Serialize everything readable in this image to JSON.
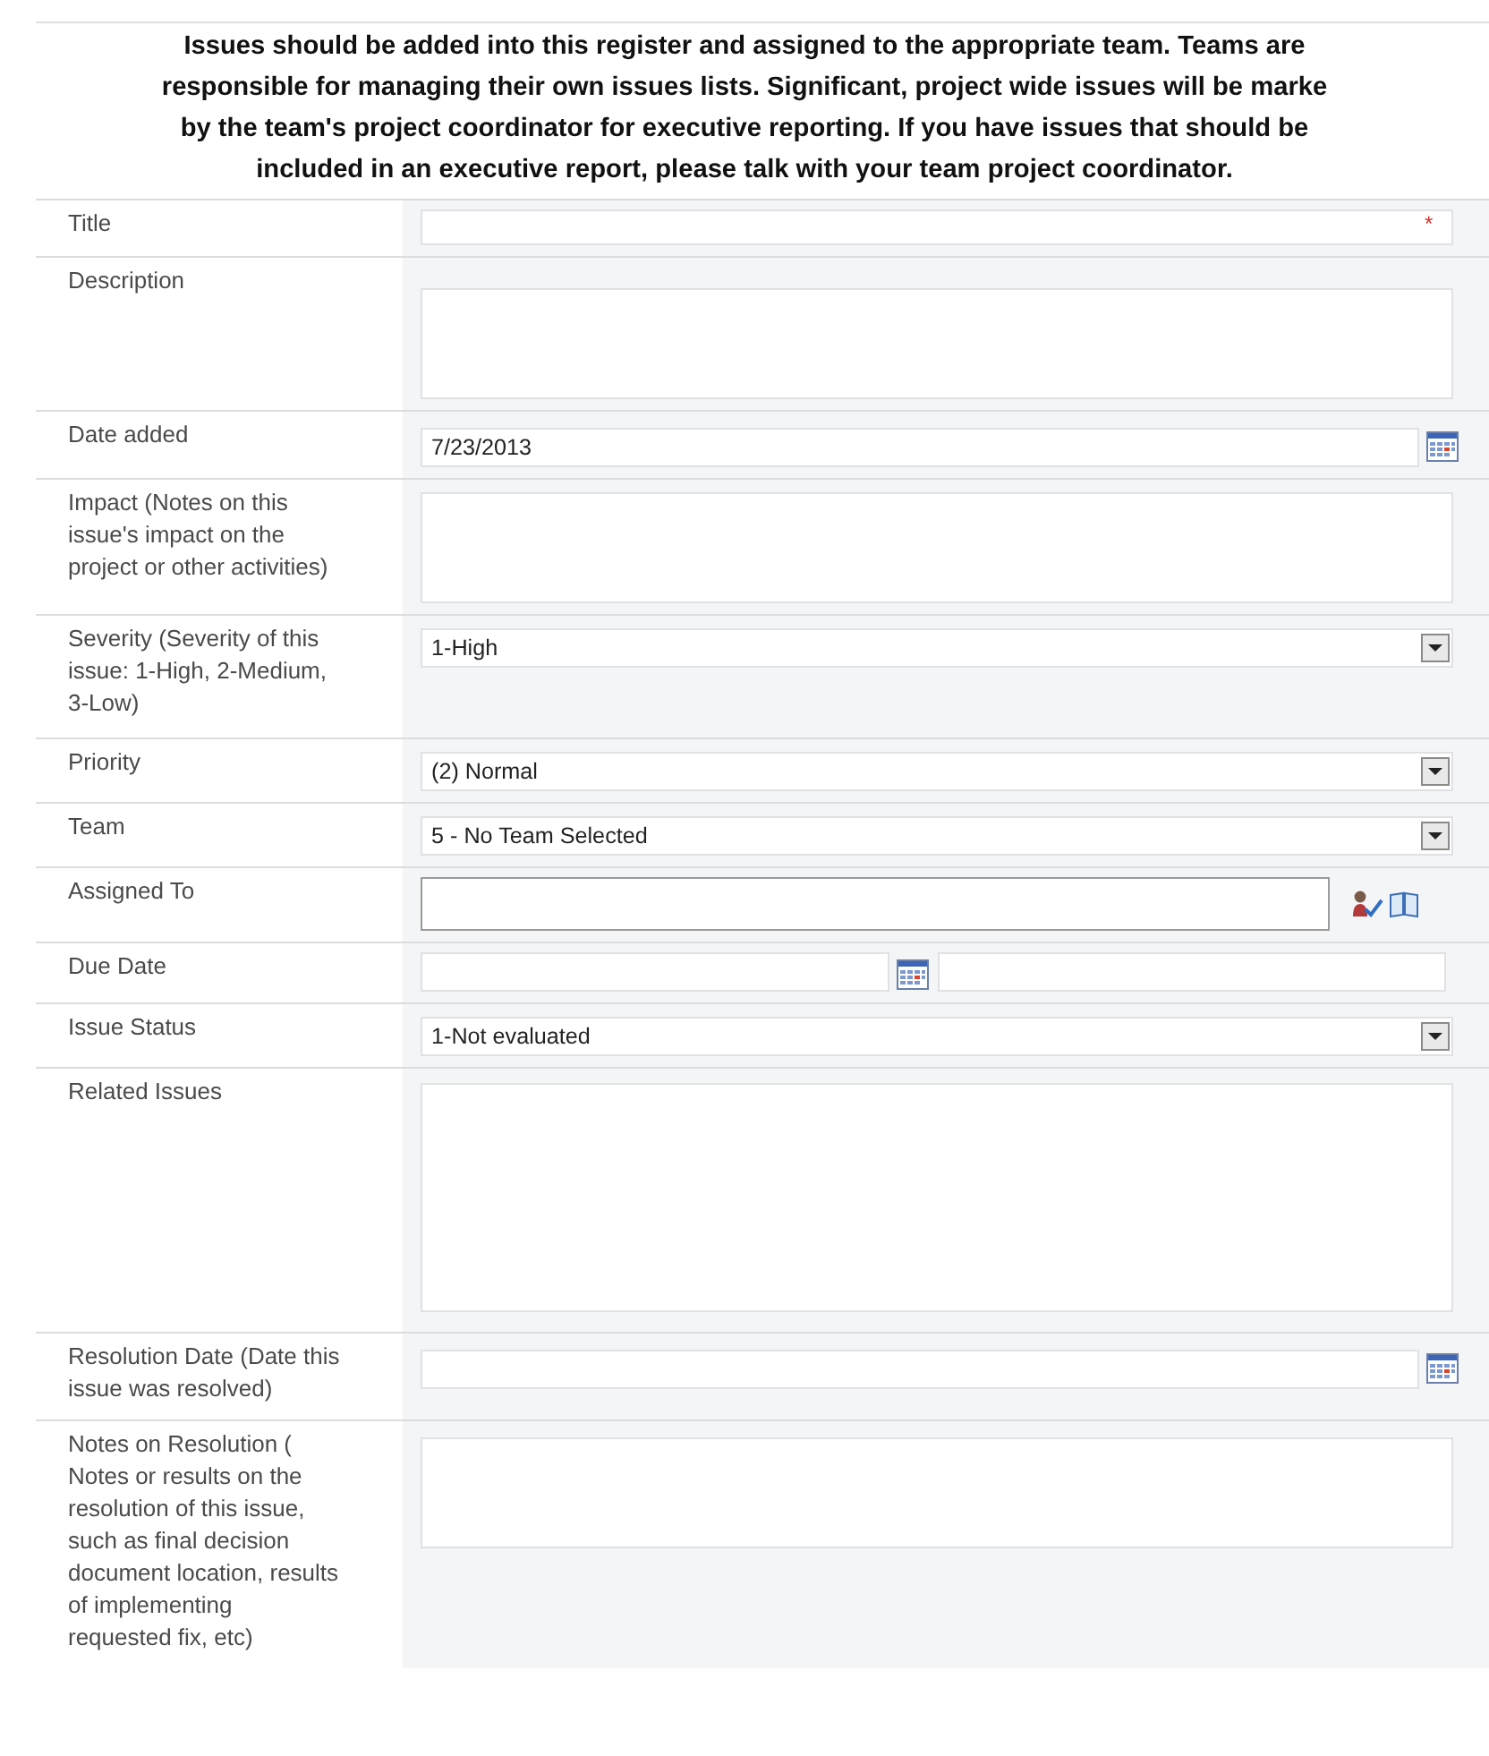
{
  "intro": {
    "lines": [
      "Issues should be added into this register and assigned to the appropriate team. Teams are",
      "responsible for managing their own issues lists. Significant, project wide issues will be marke",
      "by the team's project coordinator for executive reporting. If you have issues that should be",
      "included in an executive report, please talk with your team project coordinator."
    ]
  },
  "fields": [
    {
      "label": "Title",
      "kind": "text",
      "required": true,
      "required_mark": "*"
    },
    {
      "label": "Description",
      "kind": "textarea"
    },
    {
      "label": "Date added",
      "kind": "date",
      "value": "7/23/2013"
    },
    {
      "label": "Impact (Notes on this issue's impact on the project or other activities)",
      "kind": "textarea"
    },
    {
      "label": "Severity (Severity of this issue: 1-High, 2-Medium, 3-Low)",
      "kind": "select",
      "value": "1-High"
    },
    {
      "label": "Priority",
      "kind": "select",
      "value": "(2) Normal"
    },
    {
      "label": "Team",
      "kind": "select",
      "value": "5 - No Team Selected"
    },
    {
      "label": "Assigned To",
      "kind": "people"
    },
    {
      "label": "Due Date",
      "kind": "datetime"
    },
    {
      "label": "Issue Status",
      "kind": "select",
      "value": "1-Not evaluated"
    },
    {
      "label": "Related Issues",
      "kind": "textarea"
    },
    {
      "label": "Resolution Date (Date this issue was resolved)",
      "kind": "date"
    },
    {
      "label": "Notes on Resolution ( Notes or results on the resolution of this issue, such as final decision document location, results of implementing requested fix, etc)",
      "kind": "textarea"
    }
  ]
}
